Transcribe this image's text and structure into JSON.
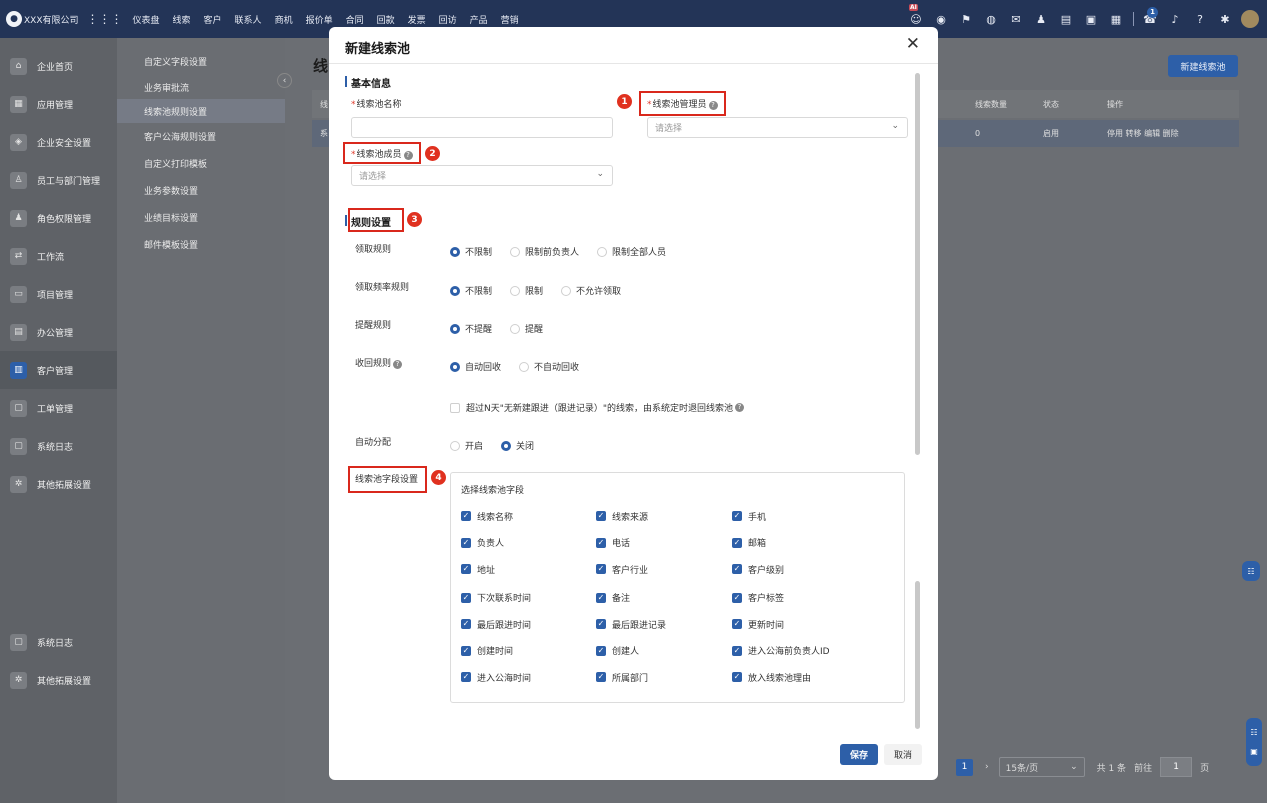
{
  "topbar": {
    "company": "XXX有限公司",
    "nav": [
      "仪表盘",
      "线索",
      "客户",
      "联系人",
      "商机",
      "报价单",
      "合同",
      "回款",
      "发票",
      "回访",
      "产品",
      "营销"
    ],
    "icons": [
      "robot-icon",
      "message-icon",
      "flag-icon",
      "globe-icon",
      "mail-icon",
      "user-icon",
      "doc-icon",
      "calendar-icon",
      "card-icon",
      "phone-icon",
      "bell-icon",
      "help-icon",
      "gear-icon"
    ],
    "ai_badge": "AI",
    "notif_count": "1"
  },
  "sidebar": {
    "items": [
      "企业首页",
      "应用管理",
      "企业安全设置",
      "员工与部门管理",
      "角色权限管理",
      "工作流",
      "项目管理",
      "办公管理",
      "客户管理",
      "工单管理",
      "系统日志",
      "其他拓展设置"
    ],
    "lower": [
      "系统日志",
      "其他拓展设置"
    ]
  },
  "submenu": {
    "items": [
      "自定义字段设置",
      "业务审批流",
      "线索池规则设置",
      "客户公海规则设置",
      "自定义打印模板",
      "业务参数设置",
      "业绩目标设置",
      "邮件模板设置"
    ]
  },
  "background": {
    "title": "线",
    "new_button": "新建线索池",
    "head_left": "线",
    "col_count": "线索数量",
    "col_status": "状态",
    "col_ops": "操作",
    "row_left": "系",
    "row_count": "0",
    "row_status": "启用",
    "row_ops": "停用  转移  编辑  删除",
    "pager_page": "1",
    "pager_next": "›",
    "pager_size": "15条/页",
    "pager_total": "共 1 条",
    "pager_goto": "前往",
    "pager_input": "1",
    "pager_unit": "页"
  },
  "modal": {
    "title": "新建线索池",
    "close": "✕",
    "basic_section": "基本信息",
    "name_label": "线索池名称",
    "manager_label": "线索池管理员",
    "manager_placeholder": "请选择",
    "member_label": "线索池成员",
    "member_placeholder": "请选择",
    "rule_section": "规则设置",
    "rules": {
      "claim_label": "领取规则",
      "claim_options": [
        "不限制",
        "限制前负责人",
        "限制全部人员"
      ],
      "freq_label": "领取频率规则",
      "freq_options": [
        "不限制",
        "限制",
        "不允许领取"
      ],
      "remind_label": "提醒规则",
      "remind_options": [
        "不提醒",
        "提醒"
      ],
      "recycle_label": "收回规则",
      "recycle_options": [
        "自动回收",
        "不自动回收"
      ],
      "recycle_checkbox": "超过N天\"无新建跟进（跟进记录）\"的线索，由系统定时退回线索池",
      "assign_label": "自动分配",
      "assign_options": [
        "开启",
        "关闭"
      ]
    },
    "field_section": "线索池字段设置",
    "field_box_title": "选择线索池字段",
    "fields": [
      "线索名称",
      "线索来源",
      "手机",
      "负责人",
      "电话",
      "邮箱",
      "地址",
      "客户行业",
      "客户级别",
      "下次联系时间",
      "备注",
      "客户标签",
      "最后跟进时间",
      "最后跟进记录",
      "更新时间",
      "创建时间",
      "创建人",
      "进入公海前负责人ID",
      "进入公海时间",
      "所属部门",
      "放入线索池理由"
    ],
    "save": "保存",
    "cancel": "取消"
  },
  "annotations": [
    "1",
    "2",
    "3",
    "4"
  ],
  "colors": {
    "primary": "#2d5fa8",
    "header": "#233457",
    "annotation": "#e0311f"
  }
}
